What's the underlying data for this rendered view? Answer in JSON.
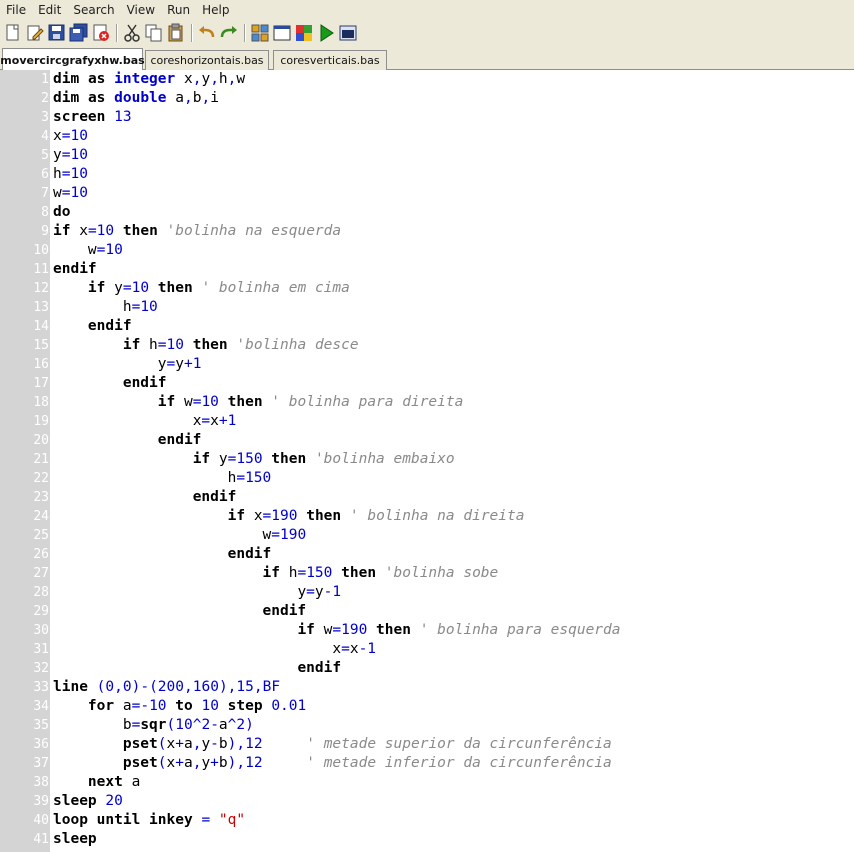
{
  "menu": [
    "File",
    "Edit",
    "Search",
    "View",
    "Run",
    "Help"
  ],
  "toolbar": [
    {
      "name": "new-file-icon"
    },
    {
      "name": "edit-file-icon"
    },
    {
      "name": "save-icon"
    },
    {
      "name": "save-all-icon"
    },
    {
      "name": "close-file-icon"
    },
    {
      "sep": true
    },
    {
      "name": "cut-icon"
    },
    {
      "name": "copy-icon"
    },
    {
      "name": "paste-icon"
    },
    {
      "sep": true
    },
    {
      "name": "undo-icon"
    },
    {
      "name": "redo-icon"
    },
    {
      "sep": true
    },
    {
      "name": "compile-icon"
    },
    {
      "name": "window-icon"
    },
    {
      "name": "color-palette-icon"
    },
    {
      "name": "run-icon"
    },
    {
      "name": "console-icon"
    }
  ],
  "colors": {
    "chrome": "#ece9d8",
    "gutter": "#d4d4d4",
    "keyword": "#000000",
    "number": "#0000cc",
    "string": "#cc0000",
    "comment": "#8a8a8a"
  },
  "tabs": [
    {
      "label": "movercircgrafyxhw.bas",
      "active": true
    },
    {
      "label": "coreshorizontais.bas",
      "active": false
    },
    {
      "label": "coresverticais.bas",
      "active": false
    }
  ],
  "code_lines": [
    "dim as integer x,y,h,w",
    "dim as double a,b,i",
    "screen 13",
    "x=10",
    "y=10",
    "h=10",
    "w=10",
    "do",
    "if x=10 then 'bolinha na esquerda",
    "    w=10",
    "endif",
    "    if y=10 then ' bolinha em cima",
    "        h=10",
    "    endif",
    "        if h=10 then 'bolinha desce",
    "            y=y+1",
    "        endif",
    "            if w=10 then ' bolinha para direita",
    "                x=x+1",
    "            endif",
    "                if y=150 then 'bolinha embaixo",
    "                    h=150",
    "                endif",
    "                    if x=190 then ' bolinha na direita",
    "                        w=190",
    "                    endif",
    "                        if h=150 then 'bolinha sobe",
    "                            y=y-1",
    "                        endif",
    "                            if w=190 then ' bolinha para esquerda",
    "                                x=x-1",
    "                            endif",
    "line (0,0)-(200,160),15,BF",
    "    for a=-10 to 10 step 0.01",
    "        b=sqr(10^2-a^2)",
    "        pset(x+a,y-b),12     ' metade superior da circunferência",
    "        pset(x+a,y+b),12     ' metade inferior da circunferência",
    "    next a",
    "sleep 20",
    "loop until inkey = \"q\"",
    "sleep"
  ]
}
